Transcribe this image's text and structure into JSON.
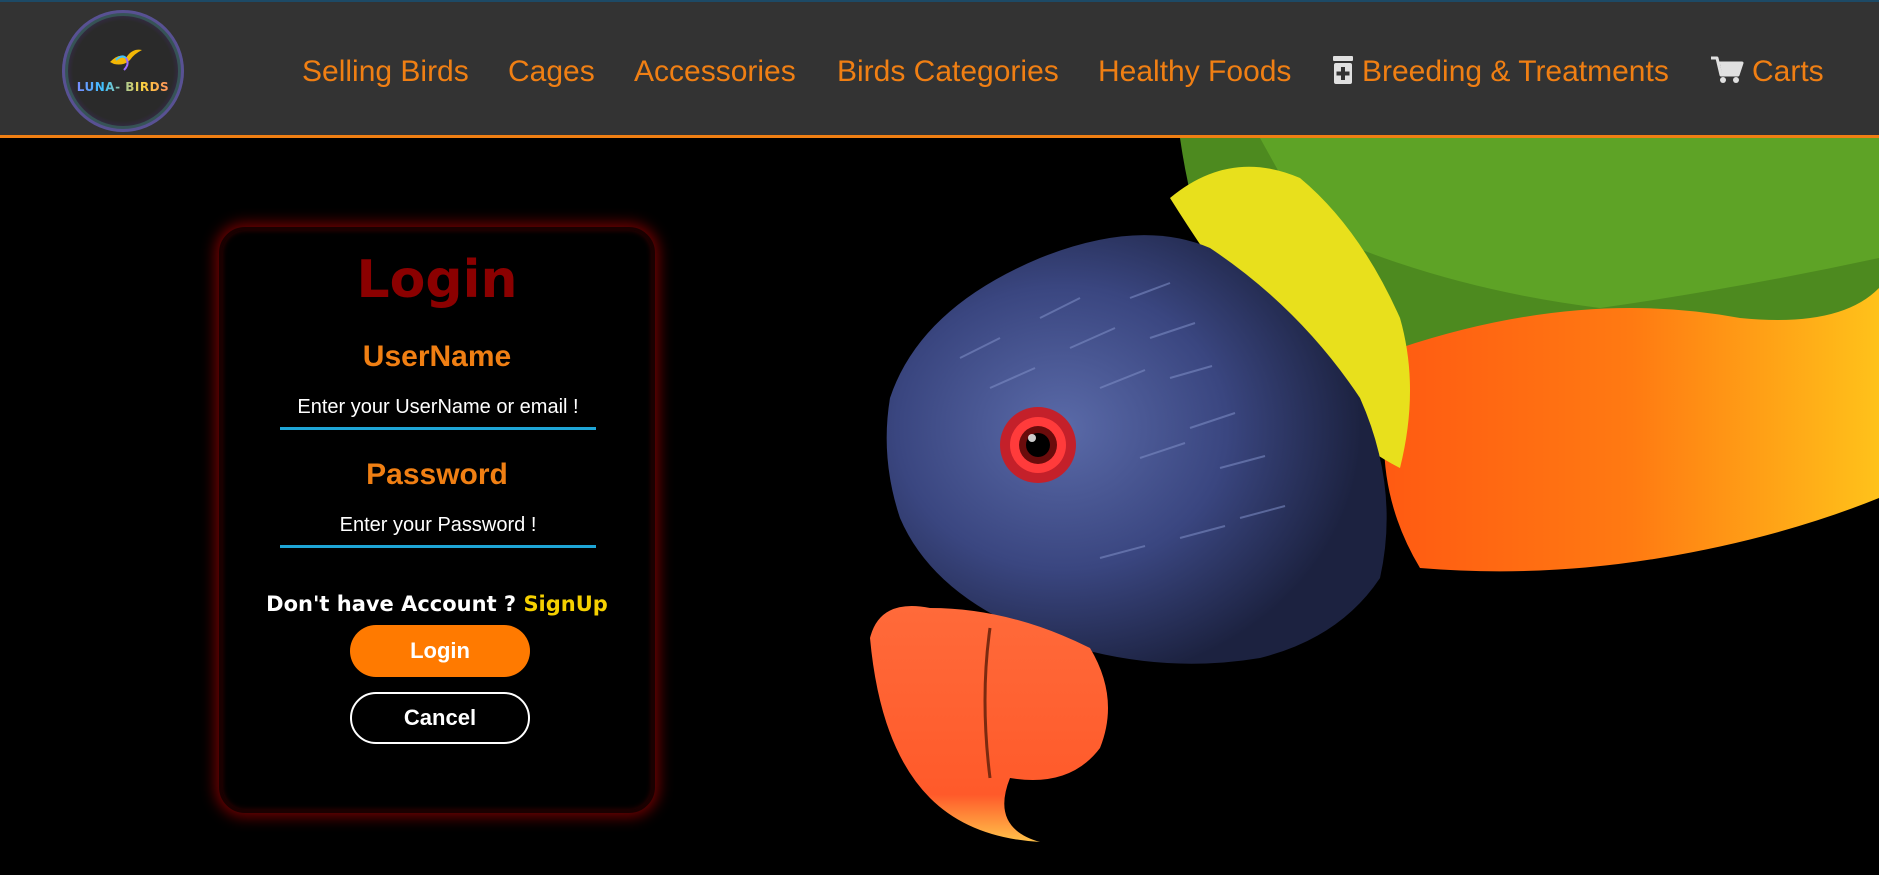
{
  "logo": {
    "text": "LUNA- BIRDS"
  },
  "nav": {
    "items": [
      {
        "label": "Selling Birds",
        "icon": ""
      },
      {
        "label": "Cages",
        "icon": ""
      },
      {
        "label": "Accessories",
        "icon": ""
      },
      {
        "label": "Birds Categories",
        "icon": ""
      },
      {
        "label": "Healthy Foods",
        "icon": ""
      },
      {
        "label": "Breeding & Treatments",
        "icon": "medical-jar-icon"
      },
      {
        "label": "Carts",
        "icon": "cart-icon"
      }
    ]
  },
  "login": {
    "title": "Login",
    "username_label": "UserName",
    "username_placeholder": "Enter your UserName or email !",
    "password_label": "Password",
    "password_placeholder": "Enter your Password !",
    "no_account_text": "Don't have Account ? ",
    "signup_label": "SignUp",
    "login_button": "Login",
    "cancel_button": "Cancel"
  },
  "colors": {
    "nav_bg": "#333333",
    "accent_orange": "#f07f13",
    "login_title": "#8b0000",
    "input_underline": "#1ea5d6",
    "signup_link": "#f5d000",
    "login_button_bg": "#ff7a00"
  }
}
